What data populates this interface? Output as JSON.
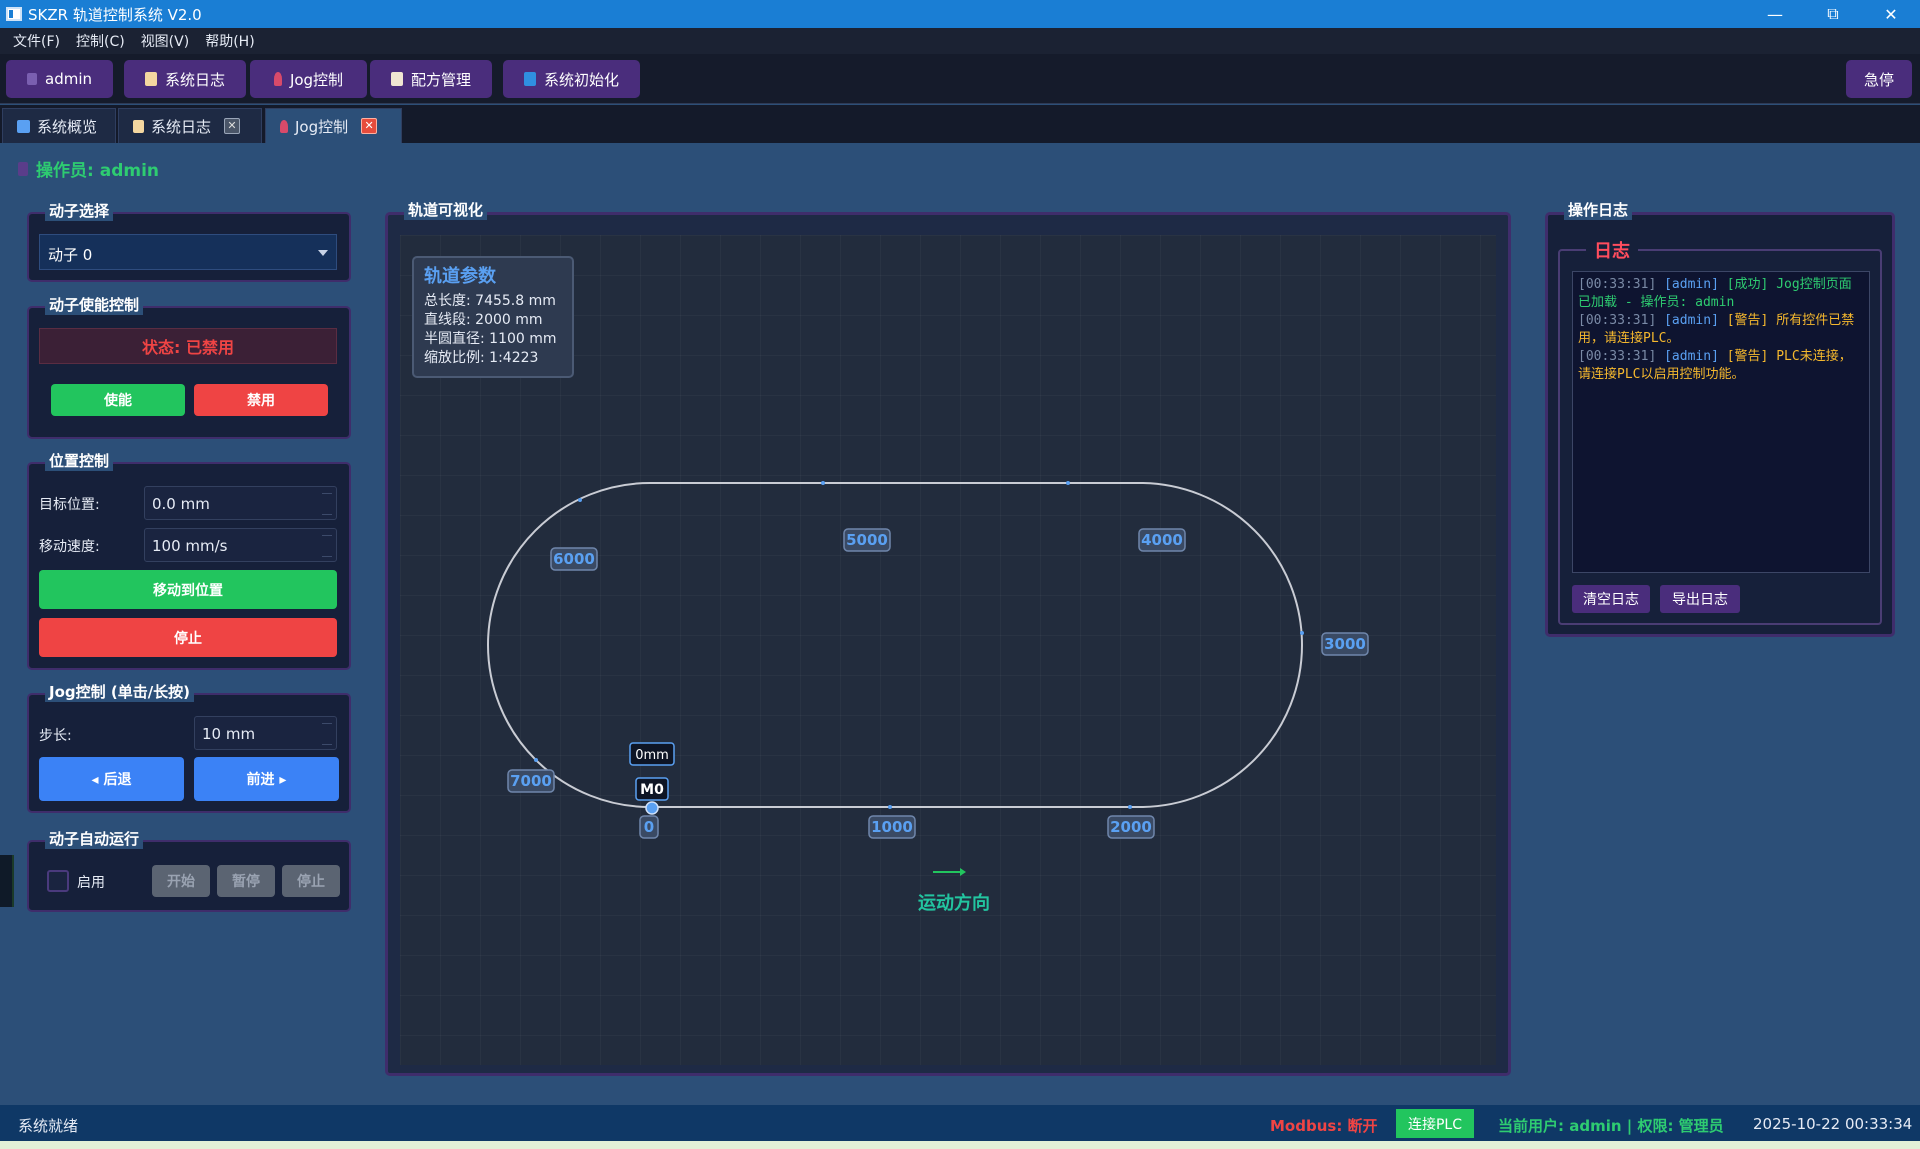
{
  "window": {
    "title": "SKZR 轨道控制系统 V2.0"
  },
  "menu": [
    "文件(F)",
    "控制(C)",
    "视图(V)",
    "帮助(H)"
  ],
  "toolbar": {
    "user": "admin",
    "log": "系统日志",
    "jog": "Jog控制",
    "recipe": "配方管理",
    "init": "系统初始化",
    "estop": "急停"
  },
  "tabs": [
    {
      "label": "系统概览"
    },
    {
      "label": "系统日志",
      "close": "✕"
    },
    {
      "label": "Jog控制",
      "close": "✕"
    }
  ],
  "operator": "操作员: admin",
  "mover_select": {
    "title": "动子选择",
    "value": "动子 0"
  },
  "enable": {
    "title": "动子使能控制",
    "status": "状态: 已禁用",
    "enable_btn": "使能",
    "disable_btn": "禁用"
  },
  "position": {
    "title": "位置控制",
    "target_label": "目标位置:",
    "target_value": "0.0 mm",
    "speed_label": "移动速度:",
    "speed_value": "100 mm/s",
    "move_btn": "移动到位置",
    "stop_btn": "停止"
  },
  "jog": {
    "title": "Jog控制 (单击/长按)",
    "step_label": "步长:",
    "step_value": "10 mm",
    "back_btn": "◂ 后退",
    "fwd_btn": "前进 ▸"
  },
  "auto": {
    "title": "动子自动运行",
    "enable_label": "启用",
    "start": "开始",
    "pause": "暂停",
    "stop": "停止"
  },
  "viz": {
    "title": "轨道可视化",
    "params_title": "轨道参数",
    "params": [
      "总长度: 7455.8 mm",
      "直线段: 2000 mm",
      "半圆直径: 1100 mm",
      "缩放比例: 1:4223"
    ],
    "labels": {
      "l0": "0",
      "l1000": "1000",
      "l2000": "2000",
      "l3000": "3000",
      "l4000": "4000",
      "l5000": "5000",
      "l6000": "6000",
      "l7000": "7000"
    },
    "mover_label": "M0",
    "mover_pos": "0mm",
    "direction": "运动方向"
  },
  "oplog": {
    "title": "操作日志",
    "inner_title": "日志",
    "entries": [
      {
        "time": "[00:33:31]",
        "user": "[admin]",
        "text": "[成功] Jog控制页面已加载 - 操作员: admin",
        "color": "#2ecc71"
      },
      {
        "time": "[00:33:31]",
        "user": "[admin]",
        "text": "[警告] 所有控件已禁用，请连接PLC。",
        "color": "#f5b82e"
      },
      {
        "time": "[00:33:31]",
        "user": "[admin]",
        "text": "[警告] PLC未连接，请连接PLC以启用控制功能。",
        "color": "#f5b82e"
      }
    ],
    "clear_btn": "清空日志",
    "export_btn": "导出日志"
  },
  "statusbar": {
    "ready": "系统就绪",
    "modbus": "Modbus: 断开",
    "connect": "连接PLC",
    "user": "当前用户: admin | 权限: 管理员",
    "datetime": "2025-10-22 00:33:34"
  }
}
